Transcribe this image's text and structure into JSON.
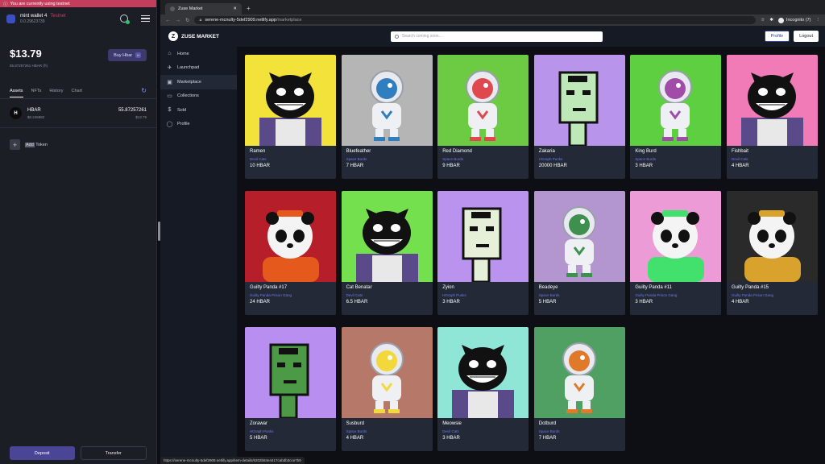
{
  "wallet": {
    "testnet_notice": "You are currently using testnet",
    "name": "mint wallet 4",
    "network": "Testnet",
    "account": "0.0.29623739",
    "balance_usd": "$13.79",
    "balance_hbar": "55.87257261 HBAR (ℏ)",
    "buy_label": "Buy Hbar",
    "buy_badge": "H",
    "tabs": [
      "Assets",
      "NFTs",
      "History",
      "Chart"
    ],
    "asset": {
      "name": "HBAR",
      "price": "$0.246882",
      "amount": "55.87257261",
      "usd": "$13.79"
    },
    "add_word": "Add",
    "add_token_label": "Token",
    "deposit_label": "Deposit",
    "transfer_label": "Transfer"
  },
  "browser": {
    "tab_title": "Zuse Market",
    "host": "serene-mcnulty-5def2909.netlify.app",
    "path": "/marketplace",
    "incognito_label": "Incognito (7)",
    "status_url": "https://serene-mcnulty-5def2909.netlify.app/item-details/6202b84e4417cabdb3cce7b9"
  },
  "market": {
    "logo_text": "ZUSE MARKET",
    "logo_mark": "Z",
    "search_placeholder": "Search coming soon...",
    "profile_label": "Profile",
    "logout_label": "Logout",
    "nav": [
      "Home",
      "Launchpad",
      "Marketplace",
      "Collections",
      "Sold",
      "Profile"
    ],
    "nav_icons": [
      "home-icon",
      "rocket-icon",
      "store-icon",
      "folder-icon",
      "sold-icon",
      "user-icon"
    ],
    "items": [
      {
        "name": "Ramen",
        "collection": "Devil Cats",
        "price": "10 HBAR",
        "bg": "#f3e23a",
        "type": "cat",
        "fg": "#111"
      },
      {
        "name": "Bluefeather",
        "collection": "Space Burds",
        "price": "7 HBAR",
        "bg": "#b5b5b5",
        "type": "burd",
        "fg": "#2f7fc0"
      },
      {
        "name": "Red Diamond",
        "collection": "Space Burds",
        "price": "9 HBAR",
        "bg": "#6ccb43",
        "type": "burd",
        "fg": "#e0484f"
      },
      {
        "name": "Zakaria",
        "collection": "HGraph Punks",
        "price": "20000 HBAR",
        "bg": "#b894ea",
        "type": "punk",
        "fg": "#bfe8b8"
      },
      {
        "name": "King Burd",
        "collection": "Space Burds",
        "price": "3 HBAR",
        "bg": "#5fcf42",
        "type": "burd",
        "fg": "#a14ca8"
      },
      {
        "name": "Fishbait",
        "collection": "Devil Cats",
        "price": "4 HBAR",
        "bg": "#f07bb6",
        "type": "cat",
        "fg": "#111"
      },
      {
        "name": "Guilty Panda #17",
        "collection": "Guilty Panda Prison Gang",
        "price": "24 HBAR",
        "bg": "#b61f2a",
        "type": "panda",
        "fg": "#e55a1c"
      },
      {
        "name": "Cat Benatar",
        "collection": "Devil Cats",
        "price": "6.5 HBAR",
        "bg": "#74e04e",
        "type": "cat",
        "fg": "#111"
      },
      {
        "name": "Zyion",
        "collection": "HGraph Punks",
        "price": "3 HBAR",
        "bg": "#b993ee",
        "type": "punk",
        "fg": "#e6f0d8"
      },
      {
        "name": "Beadeye",
        "collection": "Space Burds",
        "price": "5 HBAR",
        "bg": "#b396d0",
        "type": "burd",
        "fg": "#3f8f4f"
      },
      {
        "name": "Guilty Panda #11",
        "collection": "Guilty Panda Prison Gang",
        "price": "3 HBAR",
        "bg": "#ec9bd6",
        "type": "panda",
        "fg": "#42e06d"
      },
      {
        "name": "Guilty Panda #15",
        "collection": "Guilty Panda Prison Gang",
        "price": "4 HBAR",
        "bg": "#2a2a2a",
        "type": "panda",
        "fg": "#d9a22c"
      },
      {
        "name": "Zorawar",
        "collection": "HGraph Punks",
        "price": "5 HBAR",
        "bg": "#b88ff0",
        "type": "punk",
        "fg": "#4d9a46"
      },
      {
        "name": "Susburd",
        "collection": "Space Burds",
        "price": "4 HBAR",
        "bg": "#b67868",
        "type": "burd",
        "fg": "#f2d83a"
      },
      {
        "name": "Meowsie",
        "collection": "Devil Cats",
        "price": "3 HBAR",
        "bg": "#8fe6d6",
        "type": "cat",
        "fg": "#111"
      },
      {
        "name": "Dotburd",
        "collection": "Space Burds",
        "price": "7 HBAR",
        "bg": "#4fa062",
        "type": "burd",
        "fg": "#e07a2a"
      }
    ]
  }
}
